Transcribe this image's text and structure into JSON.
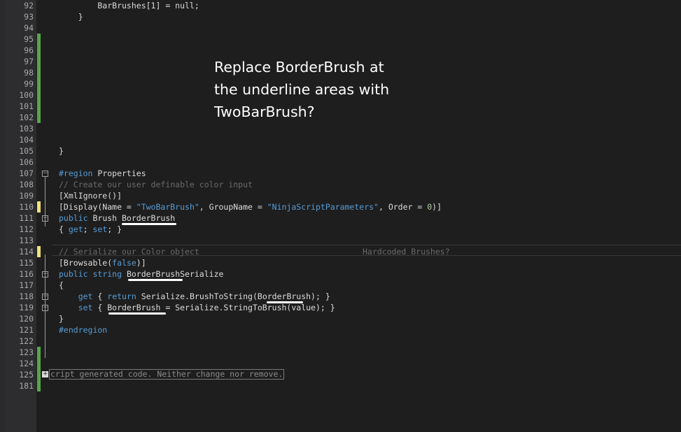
{
  "annotation": {
    "line1": "Replace BorderBrush at",
    "line2": "the underline areas with",
    "line3": "TwoBarBrush?",
    "side_note": "Hardcoded Brushes?"
  },
  "lines": [
    {
      "num": "92",
      "code": "        BarBrushes[1] = null;"
    },
    {
      "num": "93",
      "code": "    }"
    },
    {
      "num": "94",
      "code": ""
    },
    {
      "num": "95",
      "code": ""
    },
    {
      "num": "96",
      "code": ""
    },
    {
      "num": "97",
      "code": ""
    },
    {
      "num": "98",
      "code": ""
    },
    {
      "num": "99",
      "code": ""
    },
    {
      "num": "100",
      "code": ""
    },
    {
      "num": "101",
      "code": ""
    },
    {
      "num": "102",
      "code": ""
    },
    {
      "num": "103",
      "code": ""
    },
    {
      "num": "104",
      "code": ""
    },
    {
      "num": "105",
      "code": "}"
    },
    {
      "num": "106",
      "code": ""
    },
    {
      "num": "107",
      "p1": "#region",
      "p2": " Properties"
    },
    {
      "num": "108",
      "code": "// Create our user definable color input"
    },
    {
      "num": "109",
      "code": "[XmlIgnore()]"
    },
    {
      "num": "110",
      "p1": "[Display(Name = ",
      "p2": "\"TwoBarBrush\"",
      "p3": ", GroupName = ",
      "p4": "\"NinjaScriptParameters\"",
      "p5": ", Order = ",
      "p6": "0",
      "p7": ")]"
    },
    {
      "num": "111",
      "p1": "public",
      "p2": " Brush BorderBrush"
    },
    {
      "num": "112",
      "p1": "{ ",
      "p2": "get",
      "p3": "; ",
      "p4": "set",
      "p5": "; }"
    },
    {
      "num": "113",
      "code": ""
    },
    {
      "num": "114",
      "code": "// Serialize our Color object"
    },
    {
      "num": "115",
      "p1": "[Browsable(",
      "p2": "false",
      "p3": ")]"
    },
    {
      "num": "116",
      "p1": "public",
      "p2": " ",
      "p3": "string",
      "p4": " BorderBrushSerialize"
    },
    {
      "num": "117",
      "code": "{"
    },
    {
      "num": "118",
      "p1": "    ",
      "p2": "get",
      "p3": " { ",
      "p4": "return",
      "p5": " Serialize.BrushToString(BorderBrush); }"
    },
    {
      "num": "119",
      "p1": "    ",
      "p2": "set",
      "p3": " { BorderBrush = Serialize.StringToBrush(value); }"
    },
    {
      "num": "120",
      "code": "}"
    },
    {
      "num": "121",
      "p1": "#endregion"
    },
    {
      "num": "122",
      "code": ""
    },
    {
      "num": "123",
      "code": ""
    },
    {
      "num": "124",
      "code": ""
    },
    {
      "num": "125",
      "collapsed": "cript generated code. Neither change nor remove."
    },
    {
      "num": "181",
      "code": ""
    }
  ]
}
